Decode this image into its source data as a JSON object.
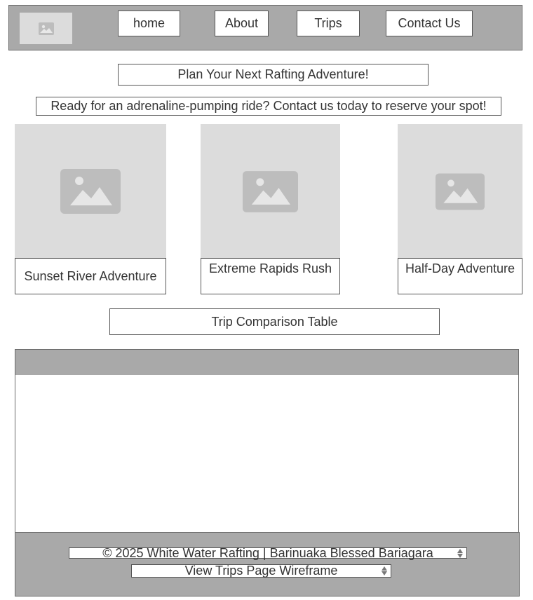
{
  "header": {
    "nav": [
      "home",
      "About",
      "Trips",
      "Contact Us"
    ]
  },
  "main": {
    "heading": "Plan Your Next Rafting Adventure!",
    "subheading": "Ready for an adrenaline-pumping ride? Contact us today to reserve your spot!",
    "cards": [
      {
        "title": "Sunset River Adventure"
      },
      {
        "title": "Extreme Rapids Rush"
      },
      {
        "title": "Half-Day Adventure"
      }
    ],
    "table_title": "Trip Comparison Table"
  },
  "footer": {
    "copyright": "© 2025 White Water Rafting | Barinuaka Blessed Bariagara",
    "view_link": "View Trips Page Wireframe"
  },
  "colors": {
    "header_bg": "#a9a9a9",
    "placeholder_bg": "#dcdcdc",
    "placeholder_icon": "#bdbdbd"
  },
  "icons": {
    "logo": "image-placeholder-icon",
    "card_image": "image-placeholder-icon",
    "select_arrows": "updown-arrow-icon"
  }
}
